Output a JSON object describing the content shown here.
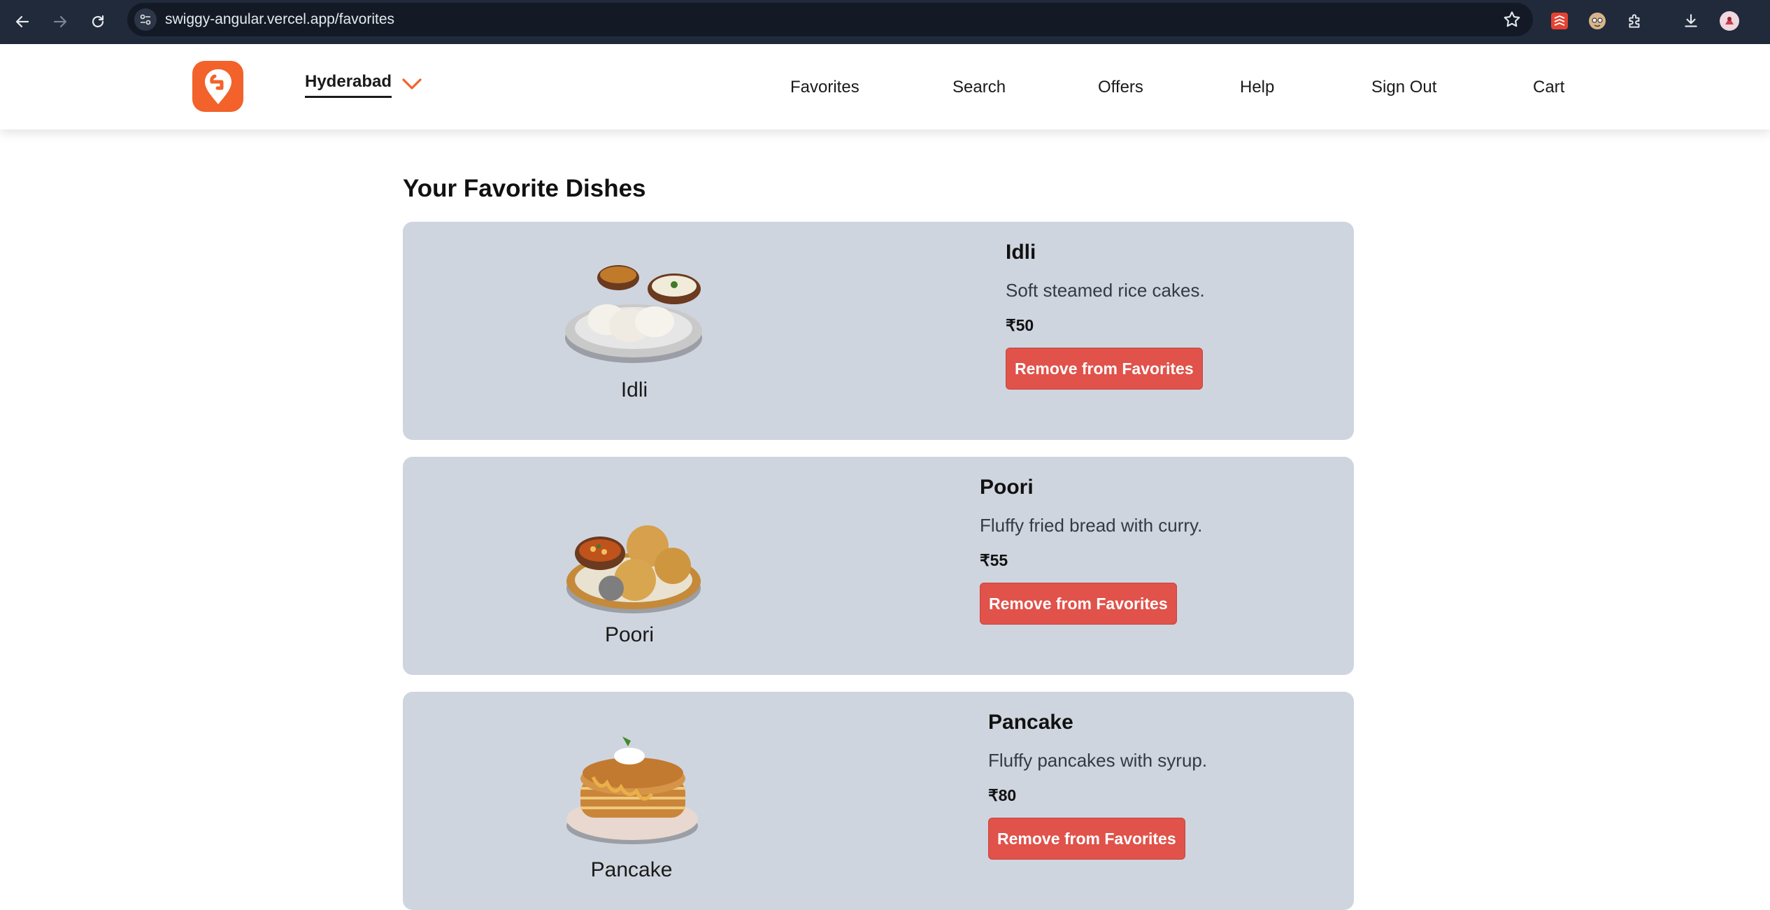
{
  "browser": {
    "url": "swiggy-angular.vercel.app/favorites",
    "icons": [
      "back-arrow-icon",
      "forward-arrow-icon",
      "reload-icon",
      "site-info-icon",
      "bookmark-star-icon",
      "todoist-extension-icon",
      "face-extension-icon",
      "extensions-puzzle-icon",
      "download-icon",
      "profile-avatar-icon"
    ]
  },
  "header": {
    "logo": "swiggy-logo-icon",
    "location": "Hyderabad",
    "nav": [
      "Favorites",
      "Search",
      "Offers",
      "Help",
      "Sign Out",
      "Cart"
    ]
  },
  "main": {
    "title": "Your Favorite Dishes",
    "favorites": [
      {
        "image_label": "Idli",
        "name": "Idli",
        "description": "Soft steamed rice cakes.",
        "price": "₹50",
        "button": "Remove from Favorites"
      },
      {
        "image_label": "Poori",
        "name": "Poori",
        "description": "Fluffy fried bread with curry.",
        "price": "₹55",
        "button": "Remove from Favorites"
      },
      {
        "image_label": "Pancake",
        "name": "Pancake",
        "description": "Fluffy pancakes with syrup.",
        "price": "₹80",
        "button": "Remove from Favorites"
      }
    ]
  },
  "colors": {
    "brand": "#f2622a",
    "card_bg": "#cfd5df",
    "button_bg": "#e0524a",
    "chrome_bg": "#202a3a"
  }
}
